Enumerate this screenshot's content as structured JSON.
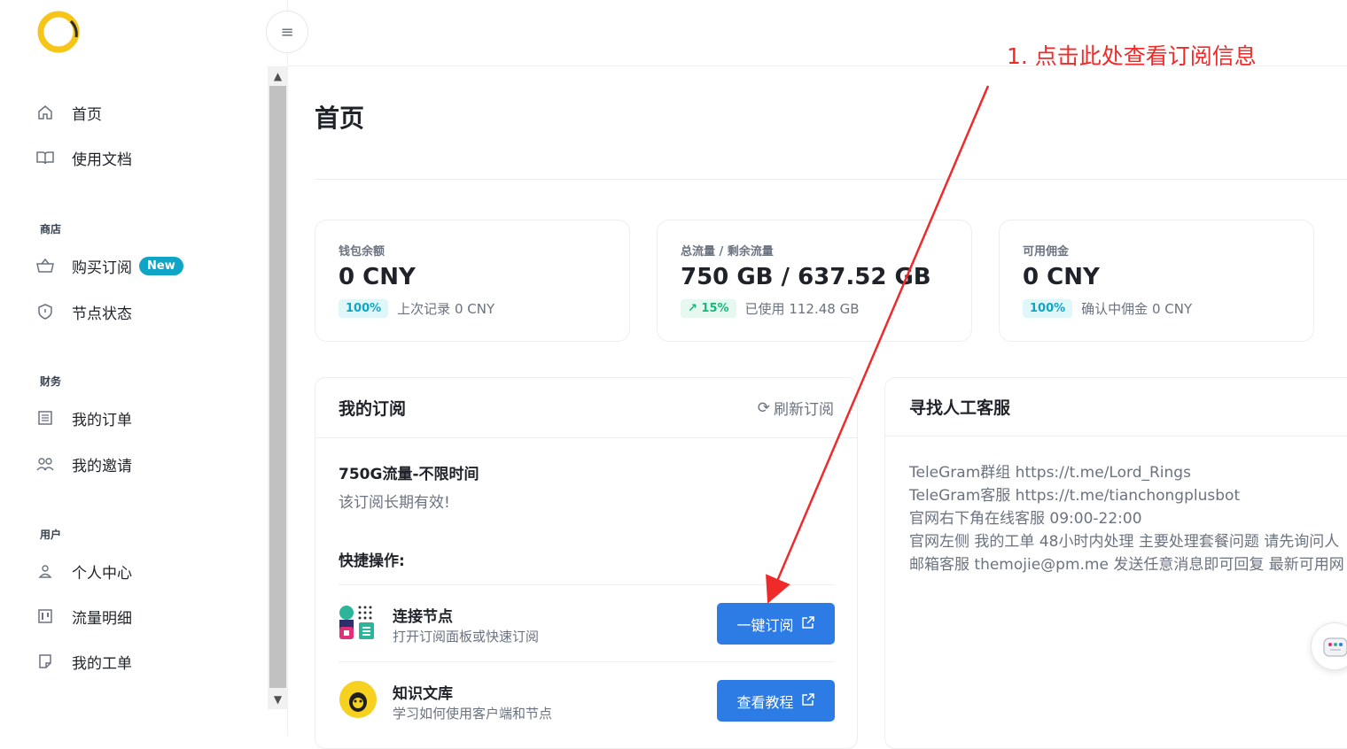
{
  "sidebar": {
    "items": [
      {
        "label": "首页",
        "icon": "home-icon"
      },
      {
        "label": "使用文档",
        "icon": "book-icon"
      },
      {
        "label": "购买订阅",
        "icon": "basket-icon",
        "badge": "New"
      },
      {
        "label": "节点状态",
        "icon": "shield-icon"
      },
      {
        "label": "我的订单",
        "icon": "list-icon"
      },
      {
        "label": "我的邀请",
        "icon": "users-icon"
      },
      {
        "label": "个人中心",
        "icon": "user-icon"
      },
      {
        "label": "流量明细",
        "icon": "chart-icon"
      },
      {
        "label": "我的工单",
        "icon": "ticket-icon"
      }
    ],
    "sections": {
      "shop": "商店",
      "finance": "财务",
      "user": "用户"
    }
  },
  "page": {
    "title": "首页"
  },
  "stats": [
    {
      "label": "钱包余额",
      "value": "0 CNY",
      "pill": "100%",
      "foot": "上次记录 0 CNY"
    },
    {
      "label": "总流量 / 剩余流量",
      "value": "750 GB / 637.52 GB",
      "pill": "15%",
      "foot": "已使用 112.48 GB"
    },
    {
      "label": "可用佣金",
      "value": "0 CNY",
      "pill": "100%",
      "foot": "确认中佣金 0 CNY"
    }
  ],
  "subscription": {
    "title": "我的订阅",
    "refresh_label": "刷新订阅",
    "plan_name": "750G流量-不限时间",
    "plan_desc": "该订阅长期有效!",
    "quick_title": "快捷操作:",
    "actions": [
      {
        "title": "连接节点",
        "subtitle": "打开订阅面板或快速订阅",
        "button": "一键订阅"
      },
      {
        "title": "知识文库",
        "subtitle": "学习如何使用客户端和节点",
        "button": "查看教程"
      }
    ]
  },
  "support": {
    "title": "寻找人工客服",
    "lines": [
      "TeleGram群组 https://t.me/Lord_Rings",
      "TeleGram客服 https://t.me/tianchongplusbot",
      "官网右下角在线客服 09:00-22:00",
      "官网左侧 我的工单 48小时内处理 主要处理套餐问题 请先询问人",
      "邮箱客服 themojie@pm.me 发送任意消息即可回复 最新可用网"
    ]
  },
  "annotation": {
    "text": "1. 点击此处查看订阅信息",
    "color": "#ef2a2a"
  },
  "colors": {
    "accent": "#2d7be5",
    "badge": "#0ea5c6",
    "green": "#14b87a"
  }
}
